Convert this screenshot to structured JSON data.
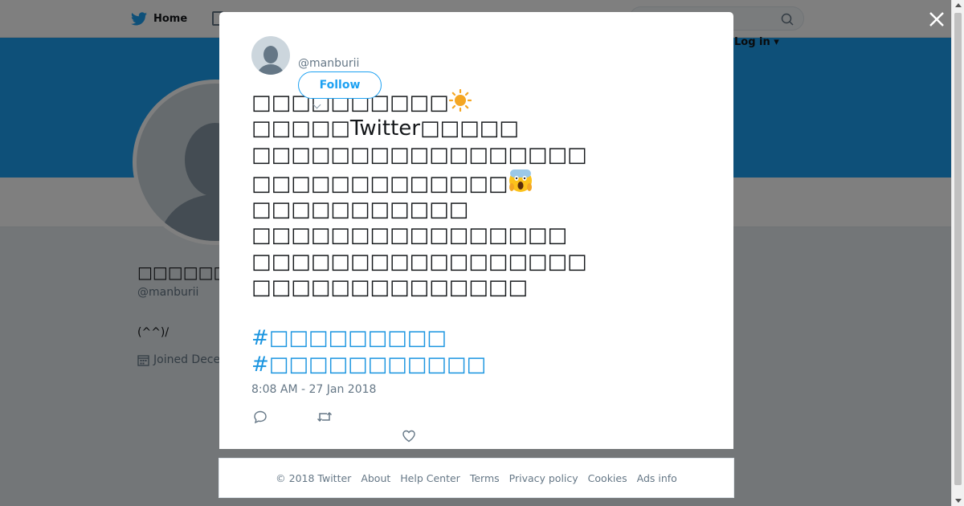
{
  "nav": {
    "home_label": "Home",
    "login_label": "Log in ▾"
  },
  "profile": {
    "name": "□□□□□□□",
    "handle": "@manburii",
    "bio": "(^^)/",
    "joined": "Joined Dece"
  },
  "tweet": {
    "handle": "@manburii",
    "follow_label": "Follow",
    "lines": [
      "□□□□□□□□□□",
      "□□□□□Twitter□□□□□",
      "□□□□□□□□□□□□□□□□□",
      "□□□□□□□□□□□□□",
      "□□□□□□□□□□□",
      "□□□□□□□□□□□□□□□□",
      "□□□□□□□□□□□□□□□□□",
      "□□□□□□□□□□□□□□"
    ],
    "hashtags": [
      "#□□□□□□□□□",
      "#□□□□□□□□□□□"
    ],
    "timestamp": "8:08 AM - 27 Jan 2018"
  },
  "footer": {
    "links": [
      "© 2018 Twitter",
      "About",
      "Help Center",
      "Terms",
      "Privacy policy",
      "Cookies",
      "Ads info"
    ]
  },
  "colors": {
    "accent": "#1da1f2",
    "banner": "#1da1f2",
    "link": "#1b95e0",
    "overlay": "rgba(0,0,0,0.5)"
  },
  "icons": [
    "twitter-bird-icon",
    "moments-icon",
    "search-icon",
    "close-icon",
    "sun-emoji-icon",
    "scream-emoji-icon",
    "reply-icon",
    "retweet-icon",
    "like-icon",
    "calendar-icon"
  ]
}
